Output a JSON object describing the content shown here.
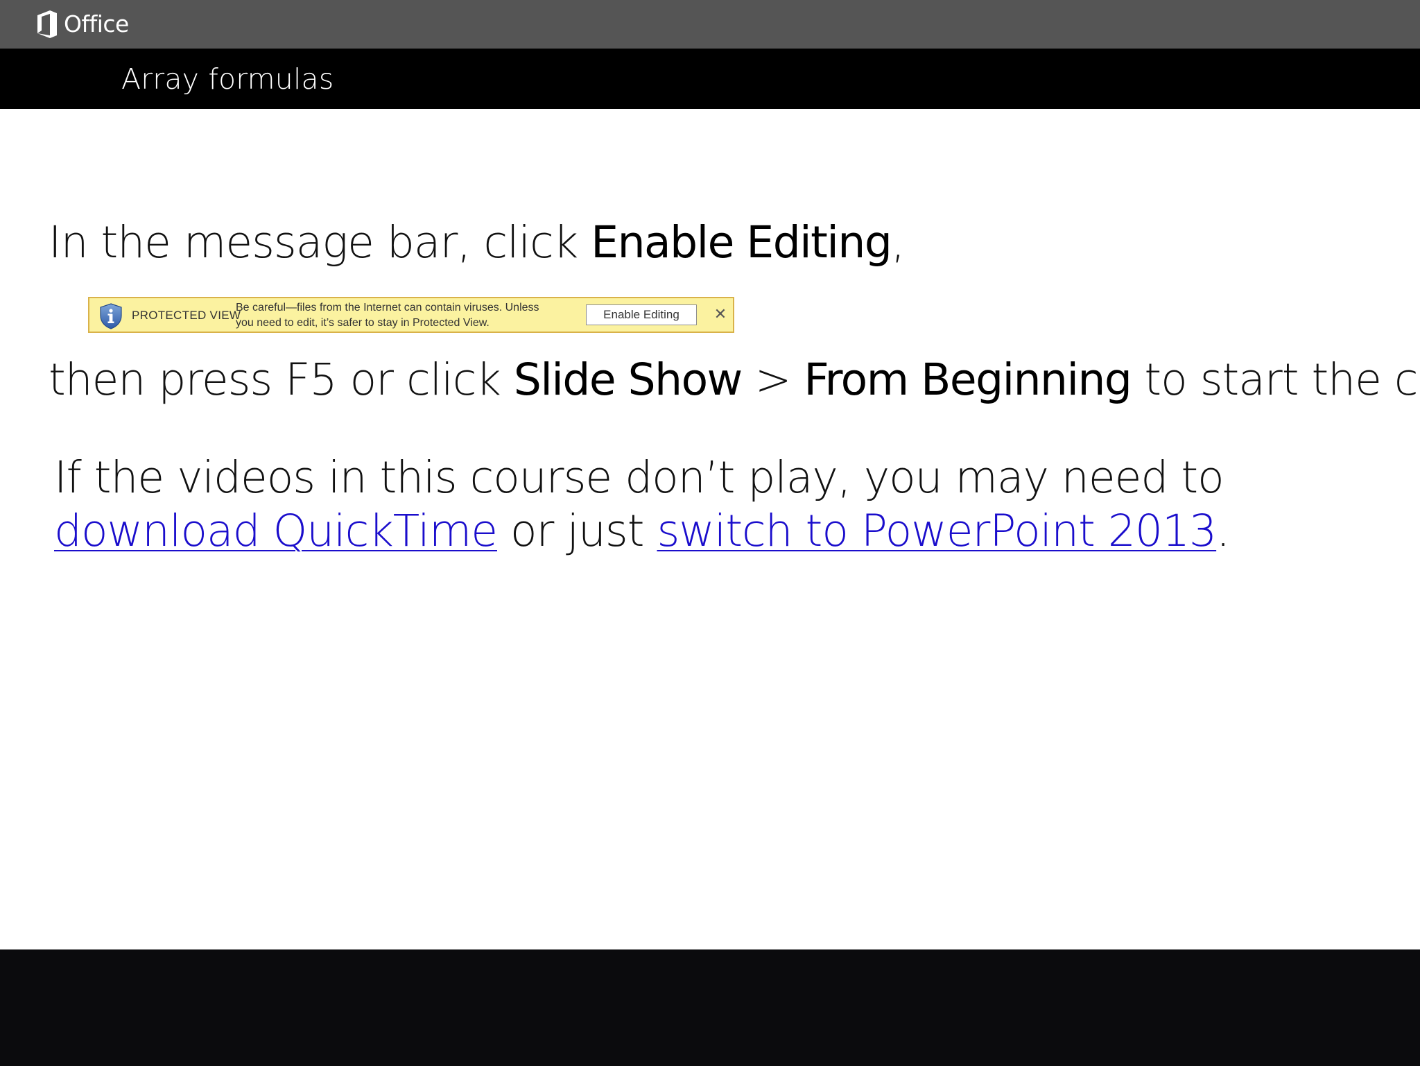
{
  "brand": {
    "name": "Office",
    "icon": "office-logo-icon"
  },
  "course": {
    "title": "Array formulas"
  },
  "instructions": {
    "line1_prefix": "In the message bar, click ",
    "line1_bold": "Enable Editing",
    "line1_suffix": ",",
    "line2_prefix": "then press F5 or click ",
    "line2_bold1": "Slide Show",
    "line2_sep": " > ",
    "line2_bold2": "From Beginning",
    "line2_suffix": " to start the course.",
    "para3_line1": "If the videos in this course don’t play, you may need to",
    "para3_link1": "download QuickTime",
    "para3_mid": " or just ",
    "para3_link2": "switch to PowerPoint 2013",
    "para3_end": "."
  },
  "message_bar": {
    "icon": "shield-info-icon",
    "label": "PROTECTED VIEW",
    "text_line1": "Be careful—files from the Internet can contain viruses. Unless",
    "text_line2": "you need to edit, it’s safer to stay in Protected View.",
    "button_label": "Enable Editing",
    "close_glyph": "✕",
    "colors": {
      "background": "#fbf2a0",
      "border": "#d9b24a"
    }
  },
  "colors": {
    "brand_bar": "#555555",
    "title_bar": "#000000",
    "link": "#1a0dcc",
    "footer": "#0b0b0d"
  }
}
